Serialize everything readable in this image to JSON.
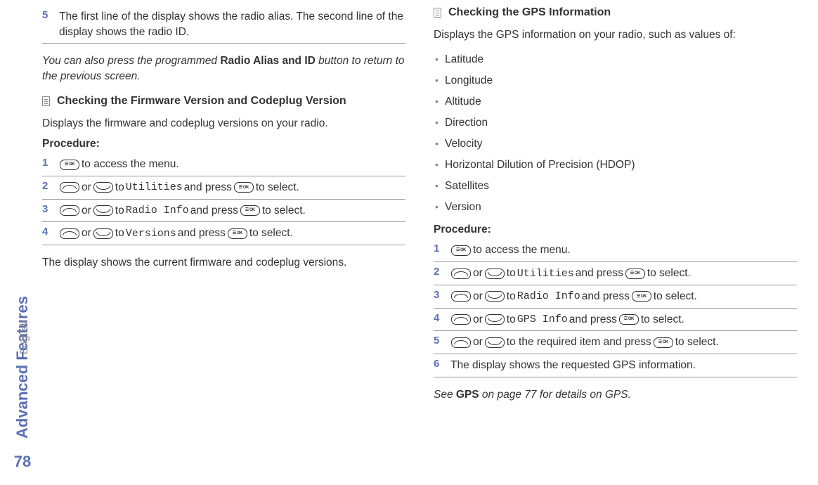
{
  "sidebar": {
    "section_label": "Advanced Features",
    "language": "English",
    "page_number": "78"
  },
  "left": {
    "step5_num": "5",
    "step5_text": "The first line of the display shows the radio alias. The second line of the display shows the radio ID.",
    "note_pre": "You can also press the programmed ",
    "note_bold": "Radio Alias and ID",
    "note_post": " button to return to the previous screen.",
    "section_title": "Checking the Firmware Version and Codeplug Version",
    "intro": "Displays the firmware and codeplug versions on your radio.",
    "procedure_label": "Procedure:",
    "steps": [
      {
        "num": "1",
        "post_icon": " to access the menu."
      },
      {
        "num": "2",
        "or": " or ",
        "to": " to ",
        "mono": "Utilities",
        "andpress": " and press ",
        "select": " to select."
      },
      {
        "num": "3",
        "or": " or ",
        "to": " to ",
        "mono": "Radio Info",
        "andpress": " and press ",
        "select": " to select."
      },
      {
        "num": "4",
        "or": " or ",
        "to": " to ",
        "mono": "Versions",
        "andpress": " and press ",
        "select": " to select."
      }
    ],
    "result": "The display shows the current firmware and codeplug versions."
  },
  "right": {
    "section_title": "Checking the GPS Information",
    "intro": "Displays the GPS information on your radio, such as values of:",
    "bullets": [
      "Latitude",
      "Longitude",
      "Altitude",
      "Direction",
      "Velocity",
      "Horizontal Dilution of Precision (HDOP)",
      "Satellites",
      "Version"
    ],
    "procedure_label": "Procedure:",
    "steps": [
      {
        "num": "1",
        "post_icon": " to access the menu."
      },
      {
        "num": "2",
        "or": " or ",
        "to": " to ",
        "mono": "Utilities",
        "andpress": " and press ",
        "select": " to select."
      },
      {
        "num": "3",
        "or": " or ",
        "to": " to ",
        "mono": "Radio Info",
        "andpress": " and press ",
        "select": " to select."
      },
      {
        "num": "4",
        "or": " or ",
        "to": " to ",
        "mono": "GPS Info",
        "andpress": " and press ",
        "select": " to select."
      },
      {
        "num": "5",
        "or": " or ",
        "to": " to the required item and press ",
        "select": " to select."
      },
      {
        "num": "6",
        "text": "The display shows the requested GPS information."
      }
    ],
    "footnote_pre": "See ",
    "footnote_bold": "GPS",
    "footnote_post": " on page 77 for details on GPS."
  }
}
